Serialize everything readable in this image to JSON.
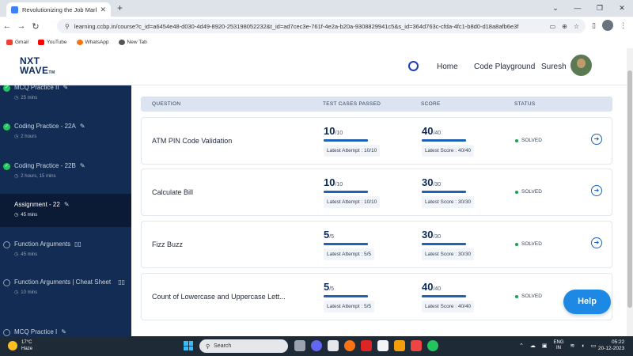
{
  "browser": {
    "tab_title": "Revolutionizing the Job Market",
    "url": "learning.ccbp.in/course?c_id=a6454e48-d030-4d49-8920-253198052232&t_id=ad7cec3e-761f-4e2a-b20a-9308829941c5&s_id=364d763c-cfda-4fc1-b8d0-d18a8afb6e3f",
    "bookmarks": [
      "Gmail",
      "YouTube",
      "WhatsApp",
      "New Tab"
    ]
  },
  "header": {
    "logo_line1": "NXT",
    "logo_line2": "WAVE",
    "logo_tm": "TM",
    "nav": [
      "Home",
      "Code Playground"
    ],
    "user": "Suresh"
  },
  "sidebar": {
    "items": [
      {
        "title": "MCQ Practice II",
        "time": "25 mins",
        "state": "done",
        "icon": "pencil"
      },
      {
        "title": "Coding Practice - 22A",
        "time": "2 hours",
        "state": "done",
        "icon": "pencil"
      },
      {
        "title": "Coding Practice - 22B",
        "time": "2 hours, 15 mins",
        "state": "done",
        "icon": "pencil"
      },
      {
        "title": "Assignment - 22",
        "time": "45 mins",
        "state": "active",
        "icon": "pencil"
      },
      {
        "title": "Function Arguments",
        "time": "45 mins",
        "state": "open",
        "icon": "book"
      },
      {
        "title": "Function Arguments | Cheat Sheet",
        "time": "10 mins",
        "state": "open",
        "icon": "book"
      },
      {
        "title": "MCQ Practice I",
        "time": "",
        "state": "open",
        "icon": "pencil"
      }
    ]
  },
  "table": {
    "headers": [
      "QUESTION",
      "TEST CASES PASSED",
      "SCORE",
      "STATUS"
    ],
    "rows": [
      {
        "question": "ATM PIN Code Validation",
        "passed": "10",
        "passed_total": "/10",
        "attempt": "Latest Attempt : 10/10",
        "score": "40",
        "score_total": "/40",
        "latest_score": "Latest Score : 40/40",
        "status": "SOLVED"
      },
      {
        "question": "Calculate Bill",
        "passed": "10",
        "passed_total": "/10",
        "attempt": "Latest Attempt : 10/10",
        "score": "30",
        "score_total": "/30",
        "latest_score": "Latest Score : 30/30",
        "status": "SOLVED"
      },
      {
        "question": "Fizz Buzz",
        "passed": "5",
        "passed_total": "/5",
        "attempt": "Latest Attempt : 5/5",
        "score": "30",
        "score_total": "/30",
        "latest_score": "Latest Score : 30/30",
        "status": "SOLVED"
      },
      {
        "question": "Count of Lowercase and Uppercase Lett...",
        "passed": "5",
        "passed_total": "/5",
        "attempt": "Latest Attempt : 5/5",
        "score": "40",
        "score_total": "/40",
        "latest_score": "Latest Score : 40/40",
        "status": "SOLVED"
      }
    ]
  },
  "help_label": "Help",
  "taskbar": {
    "temp": "17°C",
    "weather": "Haze",
    "search_placeholder": "Search",
    "lang_line1": "ENG",
    "lang_line2": "IN",
    "time": "05:22",
    "date": "20-12-2023"
  },
  "colors": {
    "sidebar_bg": "#132c53",
    "accent": "#1e63b8",
    "solved": "#16a34a",
    "help_button": "#1e88e5"
  }
}
